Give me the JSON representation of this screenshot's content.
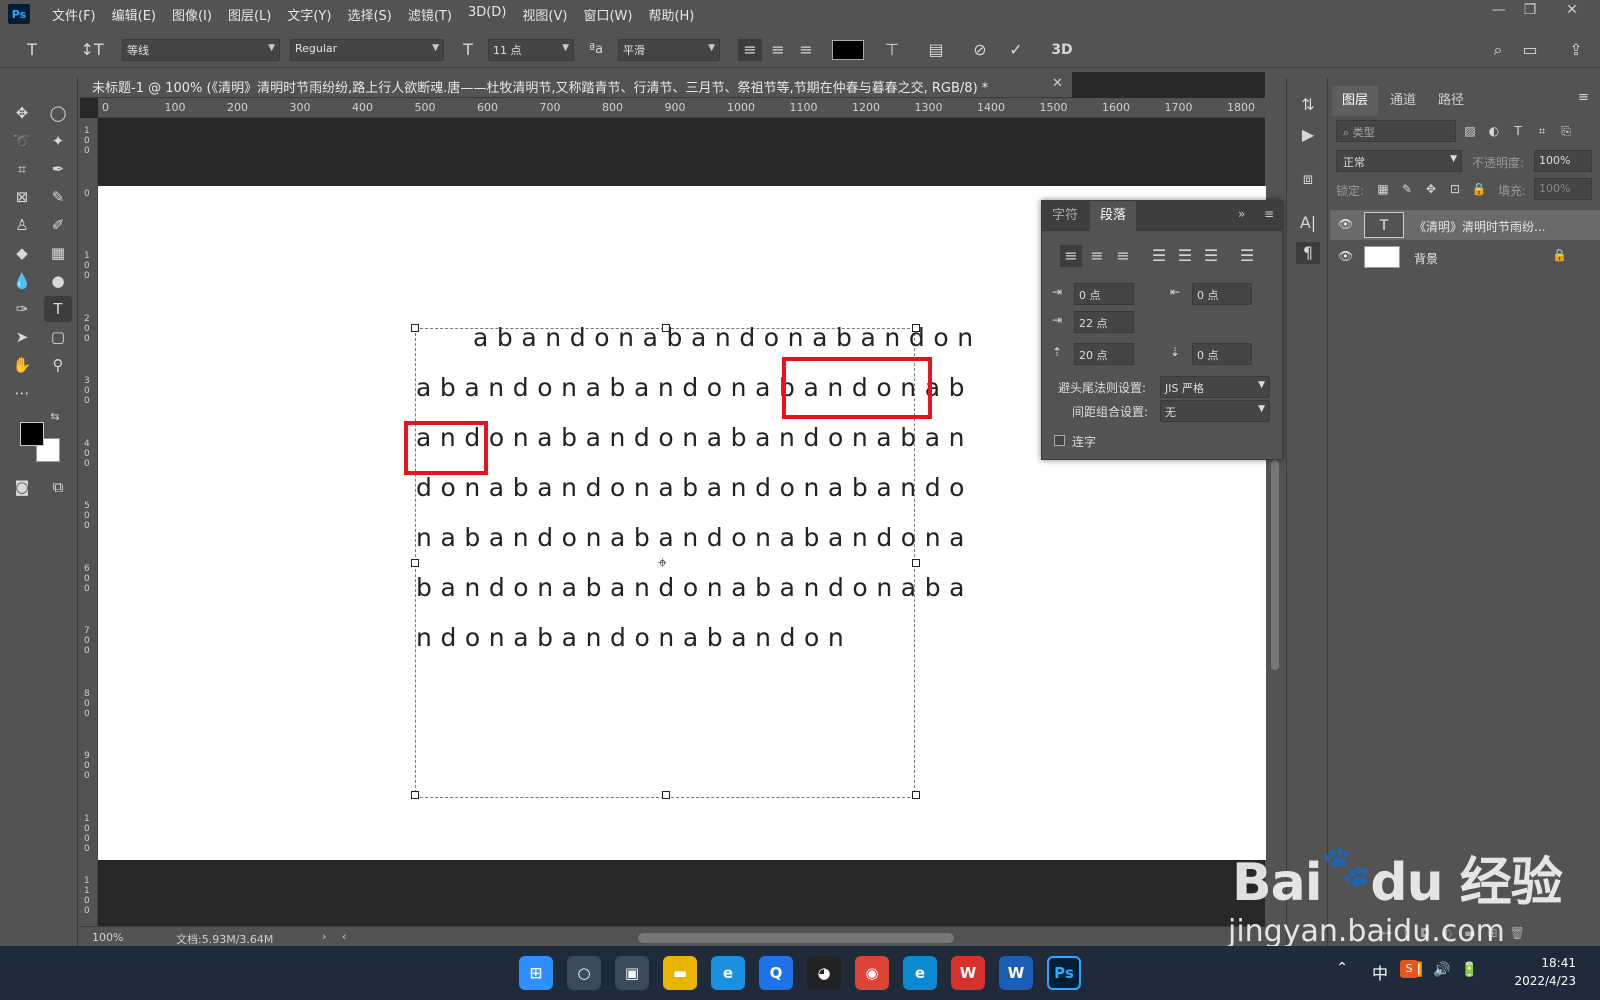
{
  "app": {
    "logo": "Ps"
  },
  "menu": [
    "文件(F)",
    "编辑(E)",
    "图像(I)",
    "图层(L)",
    "文字(Y)",
    "选择(S)",
    "滤镜(T)",
    "3D(D)",
    "视图(V)",
    "窗口(W)",
    "帮助(H)"
  ],
  "options": {
    "font_family": "等线",
    "font_style": "Regular",
    "font_size": "11 点",
    "aa_label": "ªa",
    "antialias": "平滑",
    "three_d": "3D",
    "text_color": "#000000"
  },
  "document": {
    "tab_title": "未标题-1 @ 100% (《清明》清明时节雨纷纷,路上行人欲断魂.唐——杜牧清明节,又称踏青节、行清节、三月节、祭祖节等,节期在仲春与暮春之交, RGB/8) *",
    "ruler_top": [
      "0",
      "100",
      "200",
      "300",
      "400",
      "500",
      "600",
      "700",
      "800",
      "900",
      "1000",
      "1100",
      "1200",
      "1300",
      "1400",
      "1500",
      "1600",
      "1700",
      "1800"
    ],
    "ruler_left": [
      "1\n0\n0",
      "0",
      "1\n0\n0",
      "2\n0\n0",
      "3\n0\n0",
      "4\n0\n0",
      "5\n0\n0",
      "6\n0\n0",
      "7\n0\n0",
      "8\n0\n0",
      "9\n0\n0",
      "1\n0\n0\n0",
      "1\n1\n0\n0"
    ],
    "text_lines": [
      "abandonabandonabandon",
      "abandonabandonabandonab",
      "andonabandonabandonaban",
      "donabandonabandonabando",
      "nabandonabandonabandona",
      "bandonabandonabandonaba",
      "ndonabandonabandon"
    ]
  },
  "status": {
    "zoom": "100%",
    "doc_size": "文档:5.93M/3.64M"
  },
  "paragraph_panel": {
    "tabs": [
      "字符",
      "段落"
    ],
    "active_tab": "段落",
    "indent_left": "0 点",
    "indent_right": "0 点",
    "first_line_indent": "22 点",
    "space_before": "20 点",
    "space_after": "0 点",
    "kinsoku_label": "避头尾法则设置:",
    "kinsoku_value": "JIS 严格",
    "mojikumi_label": "间距组合设置:",
    "mojikumi_value": "无",
    "hyphenate_label": "连字"
  },
  "layers_panel": {
    "tabs": [
      "图层",
      "通道",
      "路径"
    ],
    "filter_label": "类型",
    "blend_mode": "正常",
    "opacity_label": "不透明度:",
    "opacity": "100%",
    "lock_label": "锁定:",
    "fill_label": "填充:",
    "fill": "100%",
    "layers": [
      {
        "name": "《清明》清明时节雨纷...",
        "type": "text"
      },
      {
        "name": "背景",
        "type": "background"
      }
    ]
  },
  "taskbar": {
    "time": "18:41",
    "date": "2022/4/23",
    "ime": "中",
    "apps": [
      {
        "name": "start",
        "glyph": "⊞",
        "color": "#2f8fff"
      },
      {
        "name": "search",
        "glyph": "○",
        "color": "#3c4a5e"
      },
      {
        "name": "task-view",
        "glyph": "▣",
        "color": "#3c4a5e"
      },
      {
        "name": "file-explorer",
        "glyph": "▬",
        "color": "#e8b400"
      },
      {
        "name": "ie-browser",
        "glyph": "e",
        "color": "#1b8fe0"
      },
      {
        "name": "qq-browser",
        "glyph": "Q",
        "color": "#1e73e8"
      },
      {
        "name": "qq",
        "glyph": "◕",
        "color": "#222222"
      },
      {
        "name": "chrome",
        "glyph": "◉",
        "color": "#db4437"
      },
      {
        "name": "edge",
        "glyph": "e",
        "color": "#0c8ad1"
      },
      {
        "name": "wps",
        "glyph": "W",
        "color": "#d6322b"
      },
      {
        "name": "word",
        "glyph": "W",
        "color": "#1c5db6"
      },
      {
        "name": "photoshop",
        "glyph": "Ps",
        "color": "#001e36"
      }
    ]
  },
  "watermark": {
    "brand": "Bai",
    "brand2": "du",
    "title": "经验",
    "url": "jingyan.baidu.com"
  }
}
